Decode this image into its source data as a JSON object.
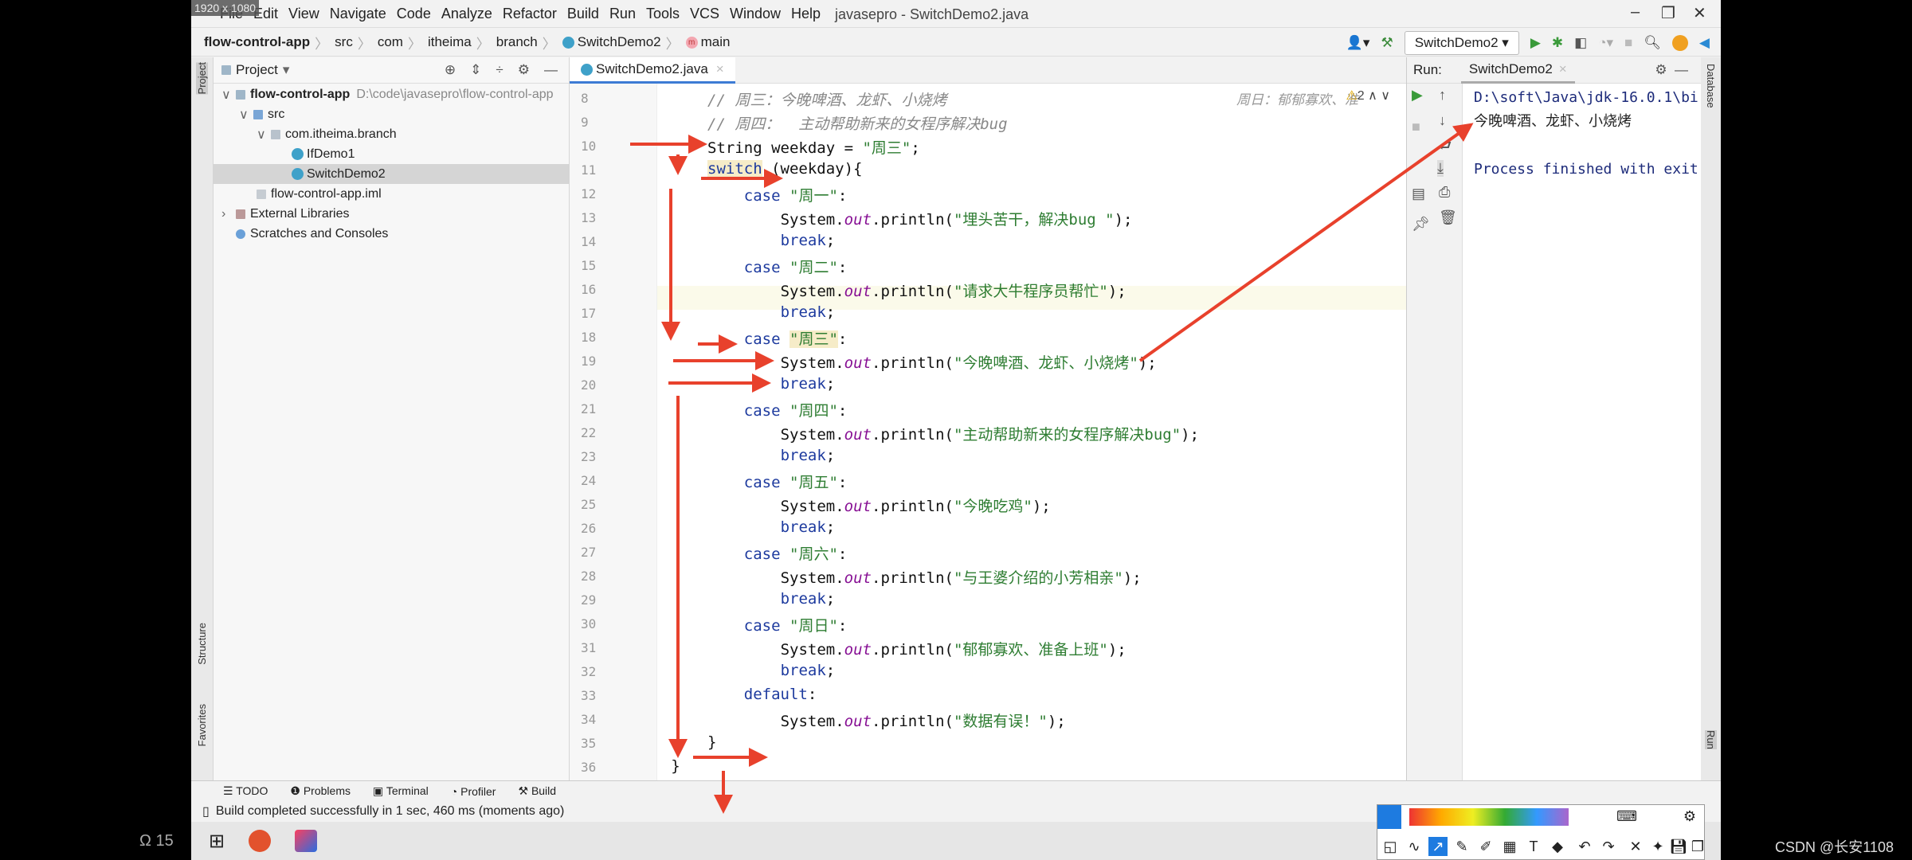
{
  "screen_badge": "1920 x 1080",
  "menu": [
    "File",
    "Edit",
    "View",
    "Navigate",
    "Code",
    "Analyze",
    "Refactor",
    "Build",
    "Run",
    "Tools",
    "VCS",
    "Window",
    "Help"
  ],
  "window_title": "javasepro - SwitchDemo2.java",
  "breadcrumb": [
    "flow-control-app",
    "src",
    "com",
    "itheima",
    "branch",
    "SwitchDemo2",
    "main"
  ],
  "run_config": "SwitchDemo2",
  "left_stripe": {
    "project": "Project",
    "structure": "Structure",
    "favorites": "Favorites"
  },
  "project_panel": {
    "title": "Project",
    "tree": [
      {
        "label": "flow-control-app",
        "path": "D:\\code\\javasepro\\flow-control-app",
        "bold": true
      },
      {
        "label": "src"
      },
      {
        "label": "com.itheima.branch"
      },
      {
        "label": "IfDemo1"
      },
      {
        "label": "SwitchDemo2",
        "selected": true
      },
      {
        "label": "flow-control-app.iml"
      },
      {
        "label": "External Libraries"
      },
      {
        "label": "Scratches and Consoles"
      }
    ]
  },
  "editor": {
    "tab": "SwitchDemo2.java",
    "inlay_hint": "周日：郁郁寡欢、准",
    "warnings": "2",
    "lines": [
      {
        "n": "8",
        "i": 0,
        "t": [
          [
            "cm",
            "// 周三：今晚啤酒、龙虾、小烧烤"
          ]
        ]
      },
      {
        "n": "9",
        "i": 0,
        "t": [
          [
            "cm",
            "// 周四：  主动帮助新来的女程序解决bug"
          ]
        ]
      },
      {
        "n": "10",
        "i": 0,
        "t": [
          [
            "",
            "String weekday = "
          ],
          [
            "s",
            "\"周三\""
          ],
          [
            "",
            ";"
          ]
        ]
      },
      {
        "n": "11",
        "i": 0,
        "t": [
          [
            "k hl",
            "switch"
          ],
          [
            "",
            " (weekday){"
          ]
        ]
      },
      {
        "n": "12",
        "i": 1,
        "t": [
          [
            "k",
            "case "
          ],
          [
            "s",
            "\"周一\""
          ],
          [
            "",
            ":"
          ]
        ]
      },
      {
        "n": "13",
        "i": 2,
        "t": [
          [
            "",
            "System."
          ],
          [
            "it",
            "out"
          ],
          [
            "",
            ".println("
          ],
          [
            "s",
            "\"埋头苦干，解决bug \""
          ],
          [
            "",
            ");"
          ]
        ]
      },
      {
        "n": "14",
        "i": 2,
        "t": [
          [
            "k",
            "break"
          ],
          [
            "",
            ";"
          ]
        ]
      },
      {
        "n": "15",
        "i": 1,
        "t": [
          [
            "k",
            "case "
          ],
          [
            "s",
            "\"周二\""
          ],
          [
            "",
            ":"
          ]
        ]
      },
      {
        "n": "16",
        "i": 2,
        "t": [
          [
            "",
            "System."
          ],
          [
            "it",
            "out"
          ],
          [
            "",
            ".println("
          ],
          [
            "s",
            "\"请求大牛程序员帮忙\""
          ],
          [
            "",
            ");"
          ]
        ]
      },
      {
        "n": "17",
        "i": 2,
        "t": [
          [
            "k",
            "break"
          ],
          [
            "",
            ";"
          ]
        ]
      },
      {
        "n": "18",
        "i": 1,
        "t": [
          [
            "k",
            "case "
          ],
          [
            "s hl",
            "\"周三\""
          ],
          [
            "",
            ":"
          ]
        ]
      },
      {
        "n": "19",
        "i": 2,
        "t": [
          [
            "",
            "System."
          ],
          [
            "it",
            "out"
          ],
          [
            "",
            ".println("
          ],
          [
            "s",
            "\"今晚啤酒、龙虾、小烧烤\""
          ],
          [
            "",
            ");"
          ]
        ]
      },
      {
        "n": "20",
        "i": 2,
        "t": [
          [
            "k",
            "break"
          ],
          [
            "",
            ";"
          ]
        ]
      },
      {
        "n": "21",
        "i": 1,
        "t": [
          [
            "k",
            "case "
          ],
          [
            "s",
            "\"周四\""
          ],
          [
            "",
            ":"
          ]
        ]
      },
      {
        "n": "22",
        "i": 2,
        "t": [
          [
            "",
            "System."
          ],
          [
            "it",
            "out"
          ],
          [
            "",
            ".println("
          ],
          [
            "s",
            "\"主动帮助新来的女程序解决bug\""
          ],
          [
            "",
            ");"
          ]
        ]
      },
      {
        "n": "23",
        "i": 2,
        "t": [
          [
            "k",
            "break"
          ],
          [
            "",
            ";"
          ]
        ]
      },
      {
        "n": "24",
        "i": 1,
        "t": [
          [
            "k",
            "case "
          ],
          [
            "s",
            "\"周五\""
          ],
          [
            "",
            ":"
          ]
        ]
      },
      {
        "n": "25",
        "i": 2,
        "t": [
          [
            "",
            "System."
          ],
          [
            "it",
            "out"
          ],
          [
            "",
            ".println("
          ],
          [
            "s",
            "\"今晚吃鸡\""
          ],
          [
            "",
            ");"
          ]
        ]
      },
      {
        "n": "26",
        "i": 2,
        "t": [
          [
            "k",
            "break"
          ],
          [
            "",
            ";"
          ]
        ]
      },
      {
        "n": "27",
        "i": 1,
        "t": [
          [
            "k",
            "case "
          ],
          [
            "s",
            "\"周六\""
          ],
          [
            "",
            ":"
          ]
        ]
      },
      {
        "n": "28",
        "i": 2,
        "t": [
          [
            "",
            "System."
          ],
          [
            "it",
            "out"
          ],
          [
            "",
            ".println("
          ],
          [
            "s",
            "\"与王婆介绍的小芳相亲\""
          ],
          [
            "",
            ");"
          ]
        ]
      },
      {
        "n": "29",
        "i": 2,
        "t": [
          [
            "k",
            "break"
          ],
          [
            "",
            ";"
          ]
        ]
      },
      {
        "n": "30",
        "i": 1,
        "t": [
          [
            "k",
            "case "
          ],
          [
            "s",
            "\"周日\""
          ],
          [
            "",
            ":"
          ]
        ]
      },
      {
        "n": "31",
        "i": 2,
        "t": [
          [
            "",
            "System."
          ],
          [
            "it",
            "out"
          ],
          [
            "",
            ".println("
          ],
          [
            "s",
            "\"郁郁寡欢、准备上班\""
          ],
          [
            "",
            ");"
          ]
        ]
      },
      {
        "n": "32",
        "i": 2,
        "t": [
          [
            "k",
            "break"
          ],
          [
            "",
            ";"
          ]
        ]
      },
      {
        "n": "33",
        "i": 1,
        "t": [
          [
            "k",
            "default"
          ],
          [
            "",
            ":"
          ]
        ]
      },
      {
        "n": "34",
        "i": 2,
        "t": [
          [
            "",
            "System."
          ],
          [
            "it",
            "out"
          ],
          [
            "",
            ".println("
          ],
          [
            "s",
            "\"数据有误！\""
          ],
          [
            "",
            ");"
          ]
        ]
      },
      {
        "n": "35",
        "i": 0,
        "t": [
          [
            "",
            "}"
          ]
        ]
      },
      {
        "n": "36",
        "i": -1,
        "t": [
          [
            "",
            "}"
          ]
        ]
      }
    ]
  },
  "run_panel": {
    "label": "Run:",
    "tab": "SwitchDemo2",
    "console": [
      "D:\\soft\\Java\\jdk-16.0.1\\bi",
      "今晚啤酒、龙虾、小烧烤",
      "",
      "Process finished with exit"
    ]
  },
  "right_stripe": {
    "database": "Database",
    "run": "Run"
  },
  "bottom_tools": [
    "TODO",
    "Problems",
    "Terminal",
    "Profiler",
    "Build"
  ],
  "status": "Build completed successfully in 1 sec, 460 ms (moments ago)",
  "watermark": "CSDN @长安1108",
  "taskbar_left": "Ω 15",
  "colors": {
    "arrow": "#e8412c",
    "accent": "#3d7bd4",
    "string": "#2e7d32",
    "keyword": "#1d3a9e"
  }
}
